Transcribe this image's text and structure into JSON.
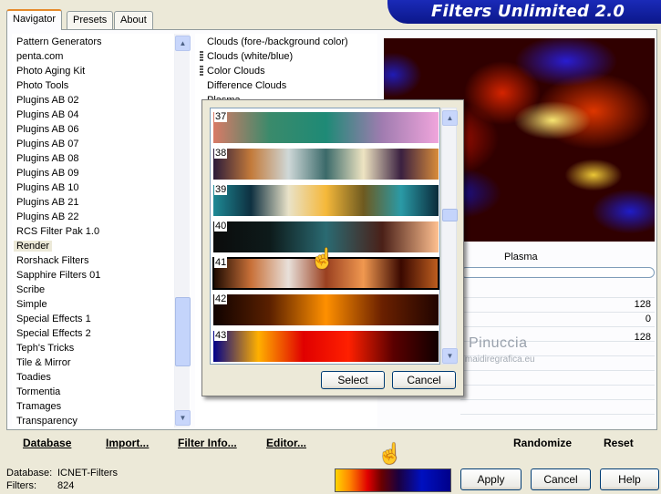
{
  "tabs": [
    {
      "label": "Navigator",
      "active": true
    },
    {
      "label": "Presets",
      "active": false
    },
    {
      "label": "About",
      "active": false
    }
  ],
  "app_title": "Filters Unlimited 2.0",
  "categories": [
    "Pattern Generators",
    "penta.com",
    "Photo Aging Kit",
    "Photo Tools",
    "Plugins AB 02",
    "Plugins AB 04",
    "Plugins AB 06",
    "Plugins AB 07",
    "Plugins AB 08",
    "Plugins AB 09",
    "Plugins AB 10",
    "Plugins AB 21",
    "Plugins AB 22",
    "RCS Filter Pak 1.0",
    "Render",
    "Rorshack Filters",
    "Sapphire Filters 01",
    "Scribe",
    "Simple",
    "Special Effects 1",
    "Special Effects 2",
    "Teph's Tricks",
    "Tile & Mirror",
    "Toadies",
    "Tormentia",
    "Tramages",
    "Transparency"
  ],
  "selected_category": "Render",
  "filters": [
    "Clouds (fore-/background color)",
    "Clouds (white/blue)",
    "Color Clouds",
    "Difference Clouds",
    "Plasma"
  ],
  "selected_filter": "Plasma",
  "filter_name": "Plasma",
  "params": [
    "128",
    "0",
    "128"
  ],
  "watermark": {
    "line1": "Pinuccia",
    "line2": "www.maidiregrafica.eu"
  },
  "actions": {
    "database": "Database",
    "import": "Import...",
    "filter_info": "Filter Info...",
    "editor": "Editor...",
    "randomize": "Randomize",
    "reset": "Reset"
  },
  "status": {
    "database_label": "Database:",
    "database_value": "ICNET-Filters",
    "filters_label": "Filters:",
    "filters_value": "824"
  },
  "buttons": {
    "apply": "Apply",
    "cancel": "Cancel",
    "help": "Help"
  },
  "gradient_picker": {
    "items": [
      {
        "number": "37",
        "colors": [
          "#d97a66",
          "#3a8a6b",
          "#1e8a76",
          "#a07cb0",
          "#f0a5dc"
        ]
      },
      {
        "number": "38",
        "colors": [
          "#2a1a3a",
          "#c37a3a",
          "#cfd8d8",
          "#3b6a6a",
          "#eee4c2",
          "#3a2040",
          "#d98c3a"
        ]
      },
      {
        "number": "39",
        "colors": [
          "#1e8a96",
          "#0e3040",
          "#e9e2c8",
          "#f5b83a",
          "#6e5a20",
          "#2a9aa6",
          "#0a2a3a"
        ]
      },
      {
        "number": "40",
        "colors": [
          "#0c0c0c",
          "#0d1a1a",
          "#2a6a72",
          "#4a2018",
          "#ffc090"
        ]
      },
      {
        "number": "41",
        "colors": [
          "#1a0800",
          "#c87038",
          "#e8e0da",
          "#9a4020",
          "#f09850",
          "#3a0800",
          "#c06020"
        ]
      },
      {
        "number": "42",
        "colors": [
          "#100200",
          "#5a2000",
          "#ff9000",
          "#6a2000",
          "#200400"
        ]
      },
      {
        "number": "43",
        "colors": [
          "#00008a",
          "#ffb000",
          "#e00000",
          "#ff2000",
          "#5a0000",
          "#100000"
        ]
      }
    ],
    "selected": "41",
    "select_label": "Select",
    "cancel_label": "Cancel"
  },
  "colors": {
    "accent_banner": "#0b178a",
    "tab_highlight": "#e68b2c"
  }
}
